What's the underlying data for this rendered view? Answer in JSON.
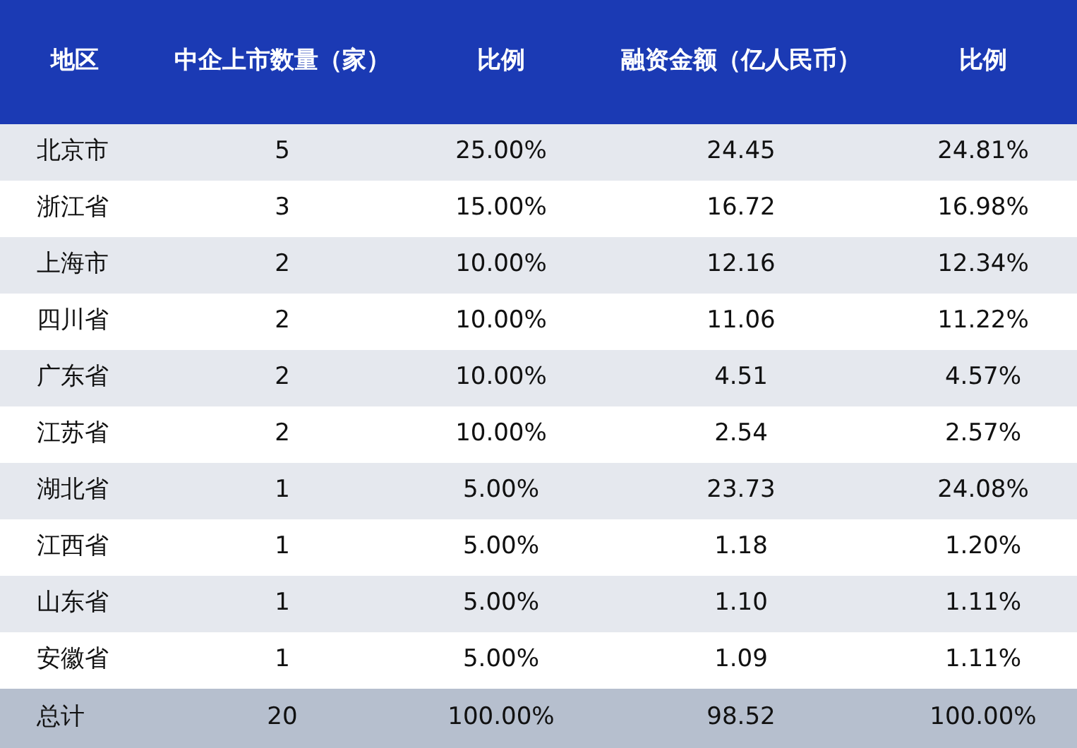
{
  "table": {
    "columns": [
      "地区",
      "中企上市数量（家）",
      "比例",
      "融资金额（亿人民币）",
      "比例"
    ],
    "rows": [
      [
        "北京市",
        "5",
        "25.00%",
        "24.45",
        "24.81%"
      ],
      [
        "浙江省",
        "3",
        "15.00%",
        "16.72",
        "16.98%"
      ],
      [
        "上海市",
        "2",
        "10.00%",
        "12.16",
        "12.34%"
      ],
      [
        "四川省",
        "2",
        "10.00%",
        "11.06",
        "11.22%"
      ],
      [
        "广东省",
        "2",
        "10.00%",
        "4.51",
        "4.57%"
      ],
      [
        "江苏省",
        "2",
        "10.00%",
        "2.54",
        "2.57%"
      ],
      [
        "湖北省",
        "1",
        "5.00%",
        "23.73",
        "24.08%"
      ],
      [
        "江西省",
        "1",
        "5.00%",
        "1.18",
        "1.20%"
      ],
      [
        "山东省",
        "1",
        "5.00%",
        "1.10",
        "1.11%"
      ],
      [
        "安徽省",
        "1",
        "5.00%",
        "1.09",
        "1.11%"
      ]
    ],
    "total": [
      "总计",
      "20",
      "100.00%",
      "98.52",
      "100.00%"
    ]
  }
}
